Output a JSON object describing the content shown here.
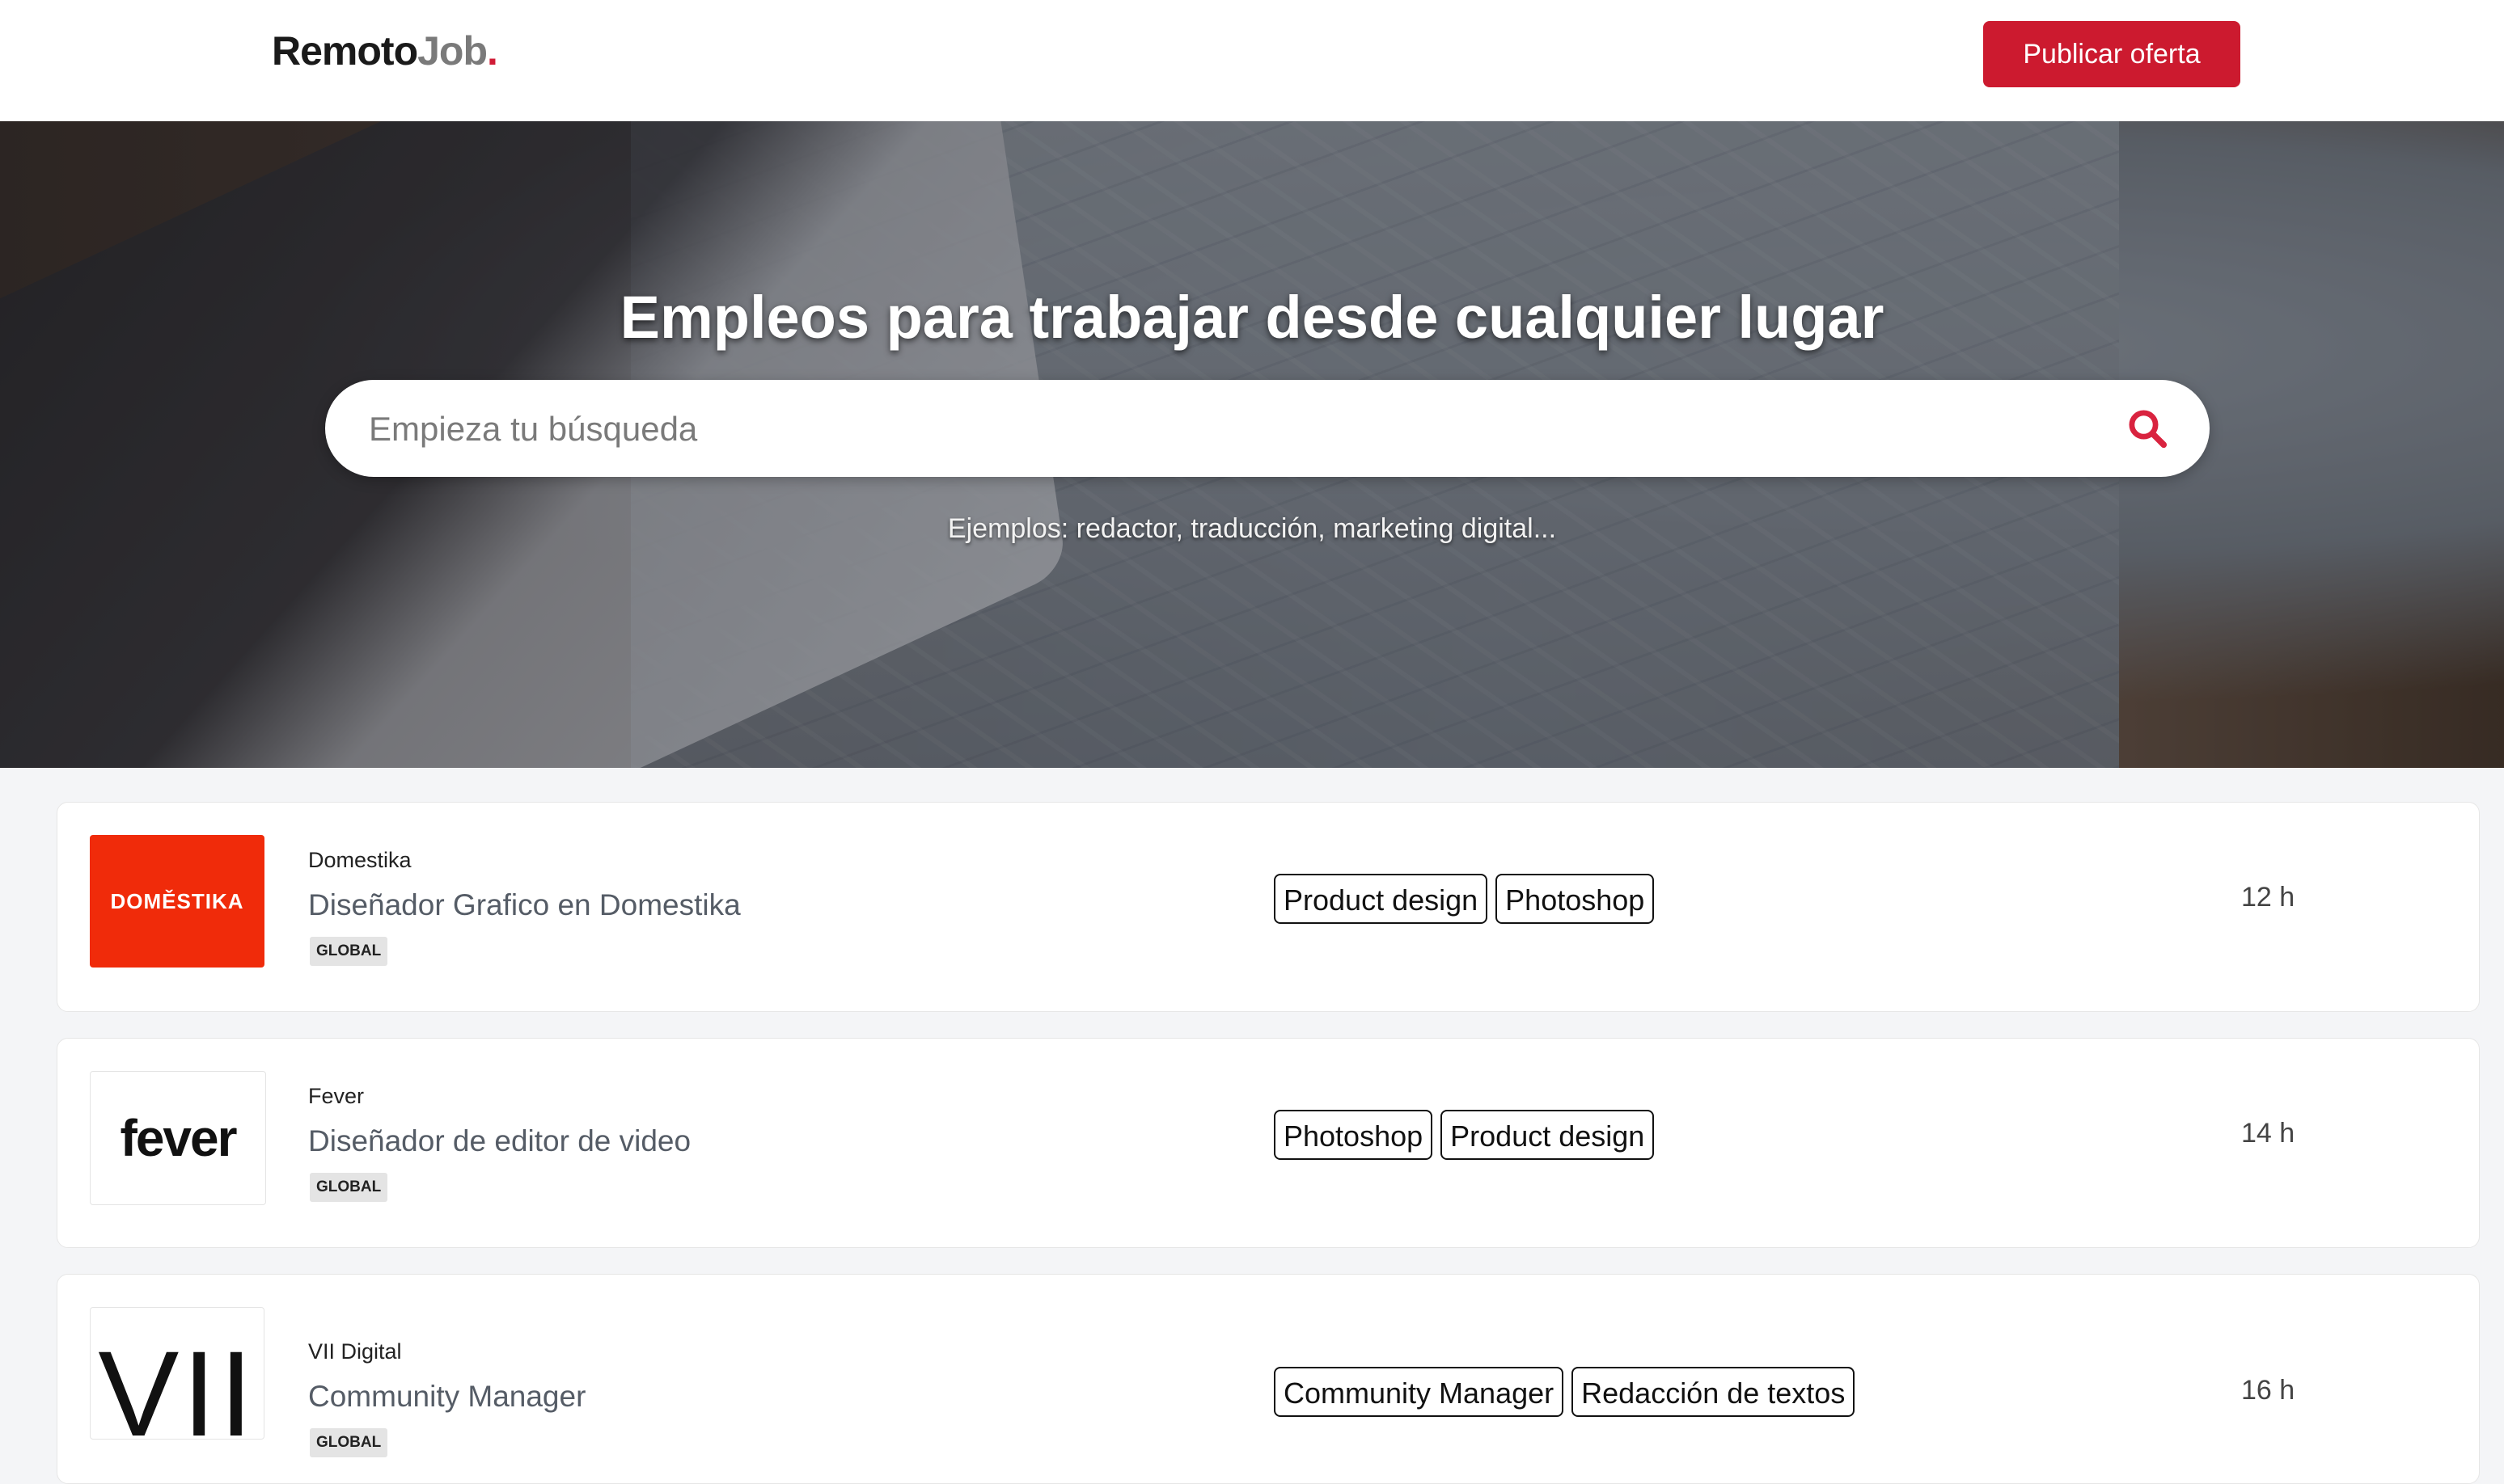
{
  "header": {
    "logo_main": "Remoto",
    "logo_accent": "Job",
    "logo_dot": ".",
    "publish_label": "Publicar oferta"
  },
  "hero": {
    "title": "Empleos para trabajar desde cualquier lugar",
    "search_placeholder": "Empieza tu búsqueda",
    "examples": "Ejemplos: redactor, traducción, marketing digital..."
  },
  "jobs": [
    {
      "company": "Domestika",
      "logo_text": "DOMĚSTIKA",
      "title": "Diseñador Grafico en Domestika",
      "region": "GLOBAL",
      "tags": [
        "Product design",
        "Photoshop"
      ],
      "time": "12 h"
    },
    {
      "company": "Fever",
      "logo_text": "fever",
      "title": "Diseñador de editor de video",
      "region": "GLOBAL",
      "tags": [
        "Photoshop",
        "Product design"
      ],
      "time": "14 h"
    },
    {
      "company": "VII Digital",
      "logo_text": "VII",
      "title": "Community Manager",
      "region": "GLOBAL",
      "tags": [
        "Community Manager",
        "Redacción de textos"
      ],
      "time": "16 h"
    }
  ],
  "colors": {
    "brand_red": "#cc1a2f",
    "domestika_red": "#f02b0a"
  },
  "icons": {
    "search": "search-icon"
  }
}
